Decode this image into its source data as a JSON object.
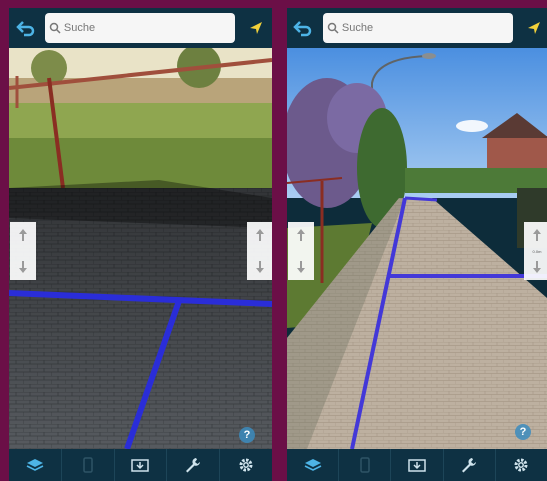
{
  "screens": [
    {
      "id": "left",
      "search": {
        "placeholder": "Suche"
      },
      "height_panel_label": "",
      "icons": {
        "back": "back-arrow-icon",
        "locate": "location-arrow-icon",
        "up": "arrow-up-icon",
        "down": "arrow-down-icon",
        "help": "help-icon",
        "tabs": [
          "layers-icon",
          "phone-icon",
          "image-icon",
          "wrench-icon",
          "gear-icon"
        ]
      }
    },
    {
      "id": "right",
      "search": {
        "placeholder": "Suche"
      },
      "height_panel_label": "0.0m",
      "icons": {
        "back": "back-arrow-icon",
        "locate": "location-arrow-icon",
        "up": "arrow-up-icon",
        "down": "arrow-down-icon",
        "help": "help-icon",
        "tabs": [
          "layers-icon",
          "phone-icon",
          "image-icon",
          "wrench-icon",
          "gear-icon"
        ]
      }
    }
  ],
  "colors": {
    "frame": "#6b0f47",
    "toolbar": "#0e3143",
    "accent_yellow": "#f2d13a",
    "accent_cyan": "#4db4e6",
    "line_marker": "#2a2dd8"
  },
  "help_label": "?"
}
